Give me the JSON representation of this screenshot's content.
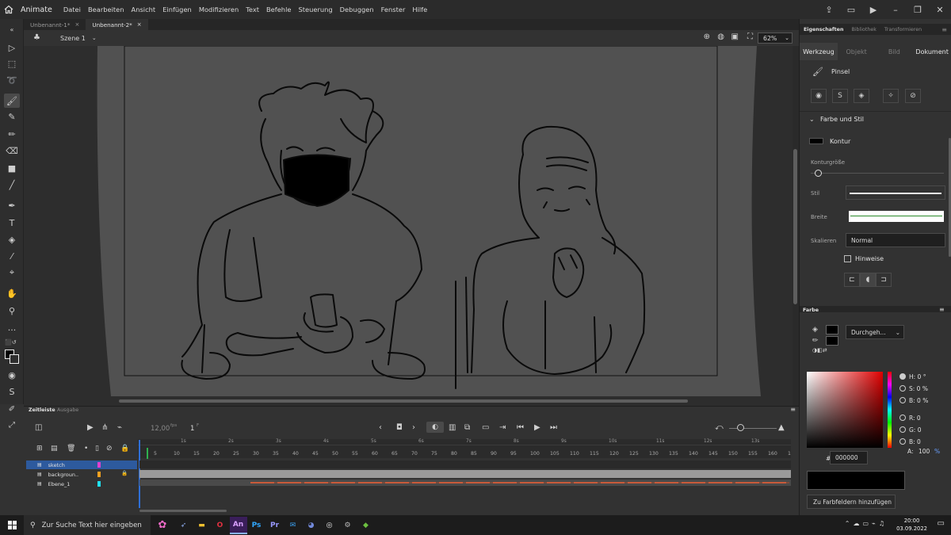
{
  "app": {
    "name": "Animate"
  },
  "menu": [
    "Datei",
    "Bearbeiten",
    "Ansicht",
    "Einfügen",
    "Modifizieren",
    "Text",
    "Befehle",
    "Steuerung",
    "Debuggen",
    "Fenster",
    "Hilfe"
  ],
  "doc_tabs": [
    {
      "label": "Unbenannt-1*"
    },
    {
      "label": "Unbenannt-2*"
    }
  ],
  "scene": {
    "label": "Szene 1"
  },
  "zoom": "62%",
  "properties": {
    "panel_tabs": [
      "Eigenschaften",
      "Bibliothek",
      "Transformieren"
    ],
    "sub_tabs": [
      "Werkzeug",
      "Objekt",
      "Bild",
      "Dokument"
    ],
    "tool_name": "Pinsel",
    "section_title": "Farbe und Stil",
    "stroke_label": "Kontur",
    "stroke_size_label": "Konturgröße",
    "style_label": "Stil",
    "width_label": "Breite",
    "scale_label": "Skalieren",
    "scale_value": "Normal",
    "hints_label": "Hinweise"
  },
  "color": {
    "title": "Farbe",
    "fill_type": "Durchgeh...",
    "h": "H: 0 °",
    "s": "S: 0 %",
    "b": "B: 0 %",
    "r": "R: 0",
    "g": "G: 0",
    "bl": "B: 0",
    "a": "A:",
    "a_value": "100",
    "a_unit": "%",
    "hex_prefix": "#",
    "hex": "000000",
    "add_swatch": "Zu Farbfeldern hinzufügen",
    "swatch_color": "#000000"
  },
  "timeline": {
    "tabs": [
      "Zeitleiste",
      "Ausgabe"
    ],
    "fps": "12,00",
    "fps_unit": "fps",
    "frame": "1",
    "frame_unit": "F",
    "seconds": [
      "1s",
      "2s",
      "3s",
      "4s",
      "5s",
      "6s",
      "7s",
      "8s",
      "9s",
      "10s",
      "11s",
      "12s",
      "13s"
    ],
    "frames": [
      "5",
      "10",
      "15",
      "20",
      "25",
      "30",
      "35",
      "40",
      "45",
      "50",
      "55",
      "60",
      "65",
      "70",
      "75",
      "80",
      "85",
      "90",
      "95",
      "100",
      "105",
      "110",
      "115",
      "120",
      "125",
      "130",
      "135",
      "140",
      "145",
      "150",
      "155",
      "160",
      "1"
    ],
    "layers": [
      {
        "name": "sketch",
        "color": "#e040d0"
      },
      {
        "name": "backgroun..",
        "color": "#f0a020"
      },
      {
        "name": "Ebene_1",
        "color": "#20e0f0"
      }
    ]
  },
  "taskbar": {
    "search_placeholder": "Zur Suche Text hier eingeben",
    "time": "20:00",
    "date": "03.09.2022",
    "apps": [
      "An",
      "Ps",
      "Pr"
    ]
  }
}
